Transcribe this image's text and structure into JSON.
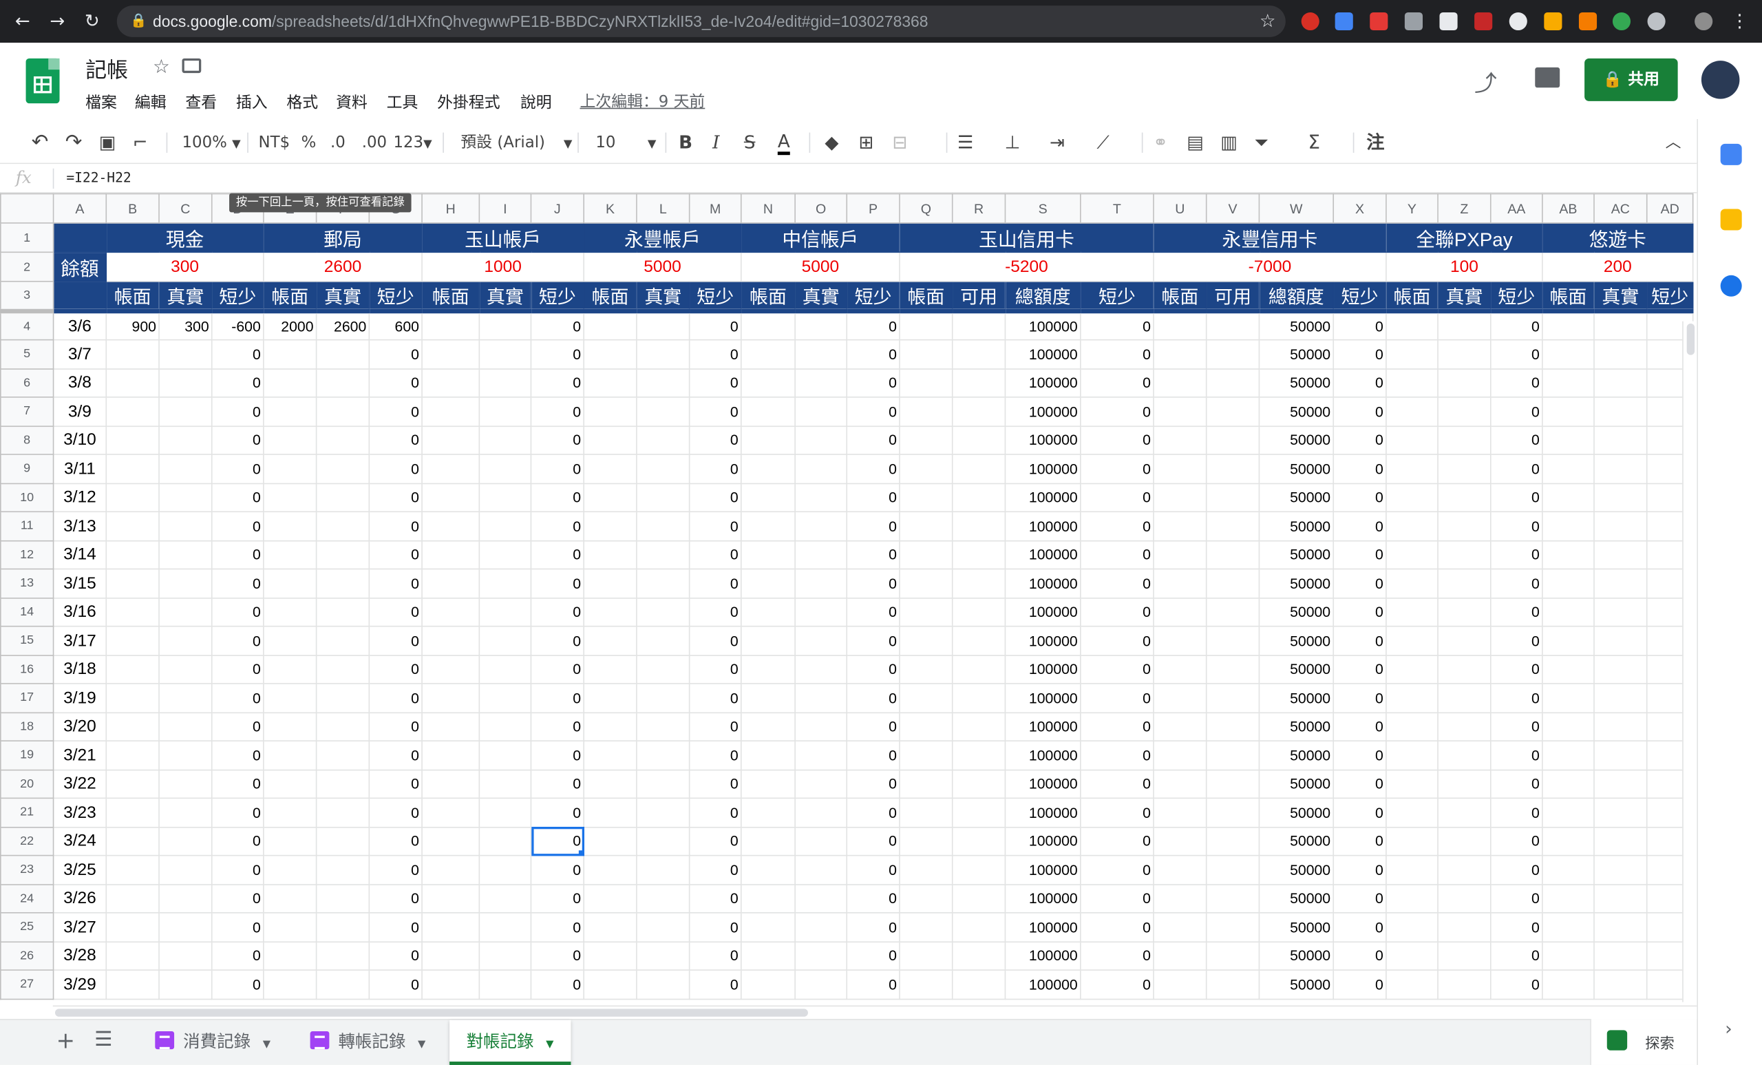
{
  "browser": {
    "url_host": "docs.google.com",
    "url_path": "/spreadsheets/d/1dHXfnQhvegwwPE1B-BBDCzyNRXTlzklI53_de-Iv2o4/edit#gid=1030278368"
  },
  "app": {
    "title": "記帳",
    "menu": [
      "檔案",
      "編輯",
      "查看",
      "插入",
      "格式",
      "資料",
      "工具",
      "外掛程式",
      "說明"
    ],
    "last_edit": "上次編輯：9 天前",
    "share_label": "共用"
  },
  "toolbar": {
    "zoom": "100%",
    "currency": "NT$",
    "percent": "%",
    "decimal_less": ".0",
    "decimal_more": ".00",
    "format_more": "123",
    "font": "預設 (Arial)",
    "font_size": "10",
    "bold": "B",
    "italic": "I",
    "strike": "S",
    "text_color": "A",
    "input_tools": "注"
  },
  "formula_bar": {
    "fx": "fx",
    "formula": "=I22-H22"
  },
  "tooltip": "按一下回上一頁，按住可查看記錄",
  "grid": {
    "columns": [
      "A",
      "B",
      "C",
      "D",
      "E",
      "F",
      "G",
      "H",
      "I",
      "J",
      "K",
      "L",
      "M",
      "N",
      "O",
      "P",
      "Q",
      "R",
      "S",
      "T",
      "U",
      "V",
      "W",
      "X",
      "Y",
      "Z",
      "AA",
      "AB",
      "AC",
      "AD"
    ],
    "row_numbers": [
      "1",
      "2",
      "3",
      "4",
      "5",
      "6",
      "7",
      "8",
      "9",
      "10",
      "11",
      "12",
      "13",
      "14",
      "15",
      "16",
      "17",
      "18",
      "19",
      "20",
      "21",
      "22",
      "23",
      "24",
      "25",
      "26",
      "27"
    ],
    "account_headers": [
      "現金",
      "郵局",
      "玉山帳戶",
      "永豐帳戶",
      "中信帳戶",
      "玉山信用卡",
      "永豐信用卡",
      "全聯PXPay",
      "悠遊卡"
    ],
    "balance_label": "餘額",
    "balances": [
      "300",
      "2600",
      "1000",
      "5000",
      "5000",
      "-5200",
      "-7000",
      "100",
      "200"
    ],
    "sub_headers": [
      "帳面",
      "真實",
      "短少",
      "帳面",
      "真實",
      "短少",
      "帳面",
      "真實",
      "短少",
      "帳面",
      "真實",
      "短少",
      "帳面",
      "真實",
      "短少",
      "帳面",
      "可用",
      "總額度",
      "短少",
      "帳面",
      "可用",
      "總額度",
      "短少",
      "帳面",
      "真實",
      "短少",
      "帳面",
      "真實",
      "短少"
    ],
    "first_row": {
      "date": "3/6",
      "b": "900",
      "c": "300",
      "d": "-600",
      "e": "2000",
      "f": "2600",
      "g": "600"
    },
    "dates": [
      "3/6",
      "3/7",
      "3/8",
      "3/9",
      "3/10",
      "3/11",
      "3/12",
      "3/13",
      "3/14",
      "3/15",
      "3/16",
      "3/17",
      "3/18",
      "3/19",
      "3/20",
      "3/21",
      "3/22",
      "3/23",
      "3/24",
      "3/25",
      "3/26",
      "3/27",
      "3/28",
      "3/29"
    ],
    "zero": "0",
    "credit_limit_yushan": "100000",
    "credit_limit_yongfeng": "50000"
  },
  "tabs": [
    {
      "label": "消費記錄"
    },
    {
      "label": "轉帳記錄"
    },
    {
      "label": "對帳記錄"
    }
  ],
  "explore_label": "探索",
  "colors": {
    "header_blue": "#1c4587",
    "balance_red": "#ee0000",
    "share_green": "#188038"
  }
}
